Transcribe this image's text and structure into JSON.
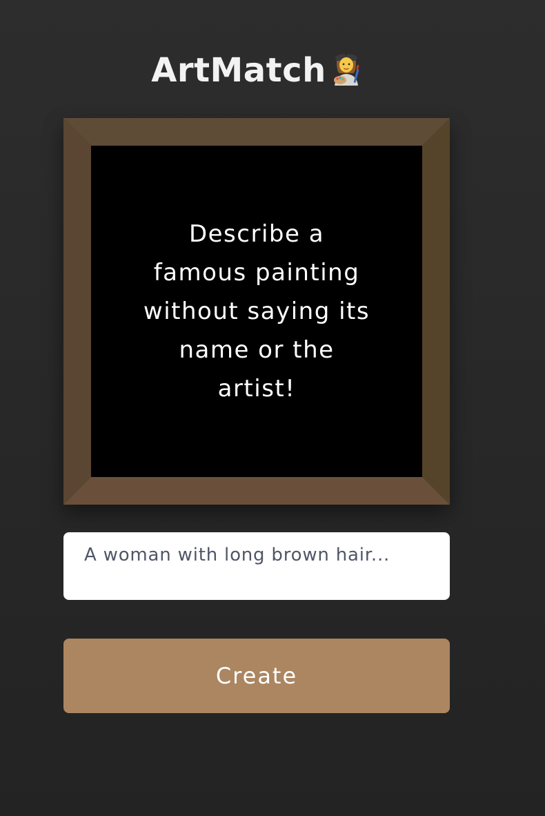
{
  "app": {
    "title": "ArtMatch",
    "title_icon": "artist-icon"
  },
  "frame": {
    "prompt_text": "Describe a famous painting without saying its name or the artist!",
    "colors": {
      "top": "#5e4c37",
      "left": "#5a4632",
      "right": "#56442a",
      "bottom": "#6a503a",
      "canvas": "#000000"
    }
  },
  "description_input": {
    "placeholder": "A woman with long brown hair...",
    "value": ""
  },
  "create_button": {
    "label": "Create",
    "color": "#ab8661"
  }
}
